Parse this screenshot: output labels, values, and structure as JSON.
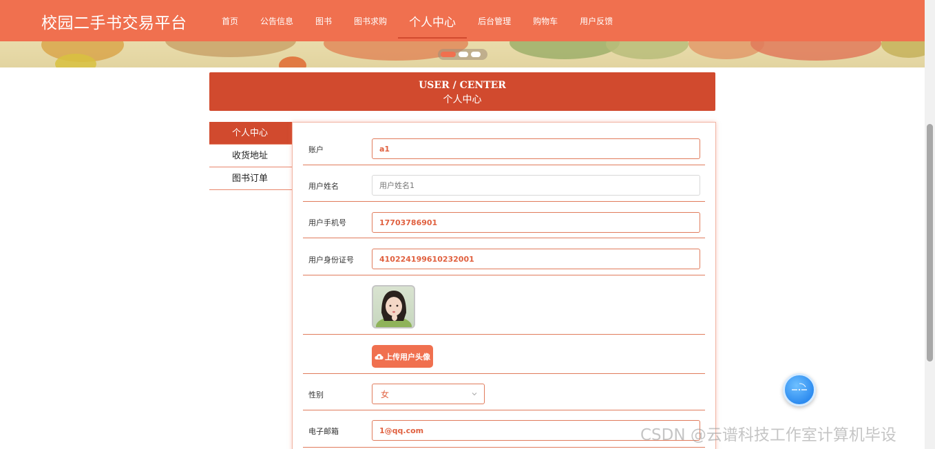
{
  "header": {
    "site_title": "校园二手书交易平台",
    "nav": [
      "首页",
      "公告信息",
      "图书",
      "图书求购",
      "个人中心",
      "后台管理",
      "购物车",
      "用户反馈"
    ],
    "active_nav": "个人中心"
  },
  "section": {
    "title_en": "USER / CENTER",
    "title_cn": "个人中心"
  },
  "side_menu": [
    "个人中心",
    "收货地址",
    "图书订单"
  ],
  "form": {
    "account_label": "账户",
    "account_value": "a1",
    "name_label": "用户姓名",
    "name_placeholder": "用户姓名1",
    "phone_label": "用户手机号",
    "phone_value": "17703786901",
    "idcard_label": "用户身份证号",
    "idcard_value": "410224199610232001",
    "upload_label": "上传用户头像",
    "gender_label": "性别",
    "gender_value": "女",
    "email_label": "电子邮箱",
    "email_value": "1@qq.com"
  },
  "watermark": "CSDN @云谱科技工作室计算机毕设",
  "colors": {
    "primary": "#f0704f",
    "accent": "#d14a2e"
  },
  "icons": {
    "upload": "cloud-upload-icon",
    "select": "chevron-down-icon",
    "float": "assistant-icon"
  }
}
